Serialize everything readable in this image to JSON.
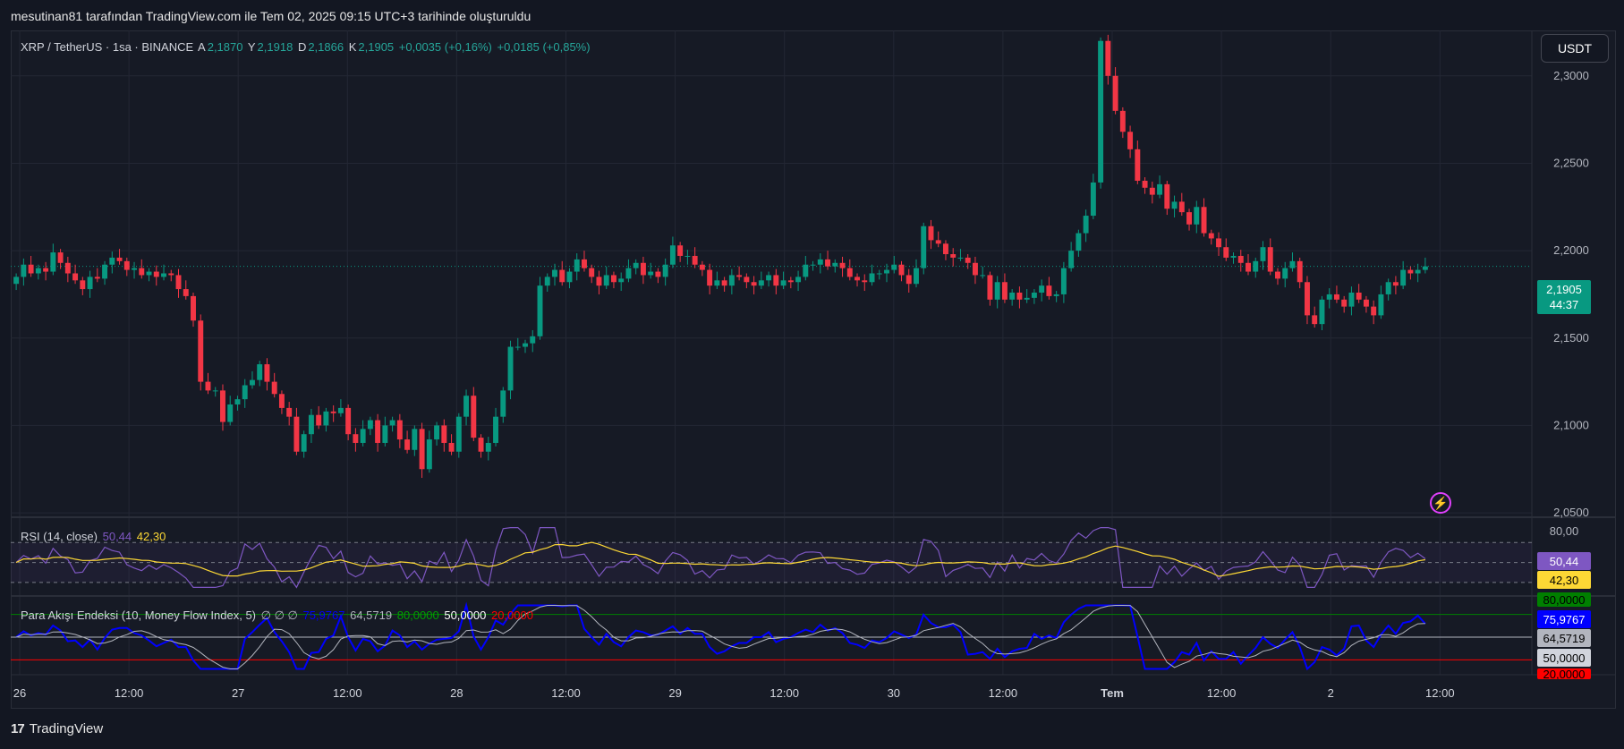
{
  "caption": "mesutinan81 tarafından TradingView.com ile Tem 02, 2025 09:15 UTC+3 tarihinde oluşturuldu",
  "legend": {
    "symbol": "XRP / TetherUS · 1sa · BINANCE",
    "open_label": "A",
    "open": "2,1870",
    "high_label": "Y",
    "high": "2,1918",
    "low_label": "D",
    "low": "2,1866",
    "close_label": "K",
    "close": "2,1905",
    "change": "+0,0035 (+0,16%)",
    "change2": "+0,0185 (+0,85%)"
  },
  "currency_button": "USDT",
  "last_price": "2,1905",
  "countdown": "44:37",
  "brand": "TradingView",
  "colors": {
    "up": "#089981",
    "down": "#f23645",
    "rsi": "#7e57c2",
    "rsi_ma": "#fdd835",
    "mfi": "#0000ff",
    "mfi_ma": "#b2b5be"
  },
  "rsi": {
    "label": "RSI (14, close)",
    "value": "50,44",
    "ma": "42,30",
    "top_tick": "80,00",
    "tag_value": "50,44",
    "tag_ma": "42,30"
  },
  "mfi": {
    "label": "Para Akışı Endeksi (10, Money Flow Index, 5)",
    "placeholders": "∅ ∅ ∅",
    "value": "75,9767",
    "ma": "64,5719",
    "upper": "80,0000",
    "middle": "50,0000",
    "lower": "20,0000"
  },
  "chart_data": {
    "type": "candlestick",
    "x_tick_labels": [
      "26",
      "12:00",
      "27",
      "12:00",
      "28",
      "12:00",
      "29",
      "12:00",
      "30",
      "12:00",
      "Tem",
      "12:00",
      "2",
      "12:00"
    ],
    "y_tick_labels": [
      "2,3000",
      "2,2500",
      "2,2000",
      "2,1500",
      "2,1000",
      "2,0500"
    ],
    "ylim": [
      2.048,
      2.326
    ],
    "candles_close": [
      2.185,
      2.192,
      2.187,
      2.19,
      2.188,
      2.199,
      2.193,
      2.187,
      2.183,
      2.178,
      2.185,
      2.184,
      2.192,
      2.196,
      2.194,
      2.189,
      2.19,
      2.186,
      2.188,
      2.185,
      2.187,
      2.186,
      2.178,
      2.174,
      2.16,
      2.125,
      2.12,
      2.12,
      2.102,
      2.112,
      2.115,
      2.123,
      2.126,
      2.135,
      2.125,
      2.118,
      2.11,
      2.105,
      2.085,
      2.095,
      2.106,
      2.1,
      2.108,
      2.107,
      2.11,
      2.095,
      2.09,
      2.098,
      2.103,
      2.09,
      2.1,
      2.103,
      2.092,
      2.086,
      2.098,
      2.075,
      2.092,
      2.1,
      2.09,
      2.085,
      2.105,
      2.117,
      2.093,
      2.085,
      2.09,
      2.105,
      2.12,
      2.145,
      2.145,
      2.147,
      2.151,
      2.18,
      2.185,
      2.189,
      2.182,
      2.188,
      2.195,
      2.19,
      2.185,
      2.18,
      2.186,
      2.182,
      2.184,
      2.19,
      2.193,
      2.186,
      2.188,
      2.185,
      2.192,
      2.203,
      2.197,
      2.197,
      2.192,
      2.189,
      2.18,
      2.183,
      2.18,
      2.186,
      2.185,
      2.182,
      2.18,
      2.183,
      2.186,
      2.18,
      2.183,
      2.182,
      2.185,
      2.192,
      2.192,
      2.195,
      2.191,
      2.193,
      2.19,
      2.185,
      2.183,
      2.182,
      2.187,
      2.187,
      2.189,
      2.192,
      2.186,
      2.181,
      2.19,
      2.214,
      2.206,
      2.204,
      2.198,
      2.196,
      2.196,
      2.193,
      2.186,
      2.186,
      2.172,
      2.182,
      2.172,
      2.176,
      2.172,
      2.173,
      2.176,
      2.18,
      2.174,
      2.175,
      2.19,
      2.2,
      2.21,
      2.22,
      2.239,
      2.32,
      2.3,
      2.28,
      2.268,
      2.258,
      2.24,
      2.236,
      2.232,
      2.238,
      2.224,
      2.228,
      2.222,
      2.215,
      2.225,
      2.21,
      2.207,
      2.202,
      2.196,
      2.197,
      2.193,
      2.188,
      2.194,
      2.202,
      2.188,
      2.184,
      2.19,
      2.194,
      2.182,
      2.163,
      2.158,
      2.172,
      2.175,
      2.172,
      2.168,
      2.176,
      2.172,
      2.168,
      2.163,
      2.175,
      2.182,
      2.18,
      2.189,
      2.187,
      2.189,
      2.191
    ]
  }
}
